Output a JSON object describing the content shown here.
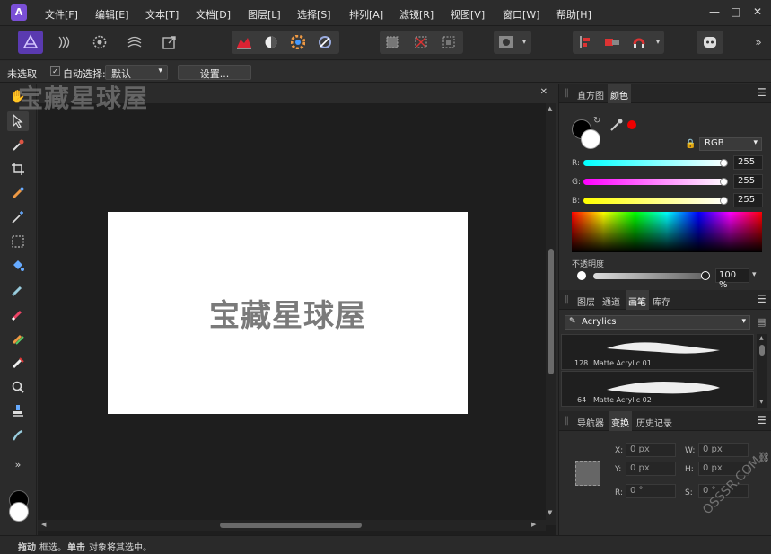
{
  "app": {
    "logo_letter": "A",
    "accent": "#7a4fd6"
  },
  "menu": [
    "文件[F]",
    "编辑[E]",
    "文本[T]",
    "文档[D]",
    "图层[L]",
    "选择[S]",
    "排列[A]",
    "滤镜[R]",
    "视图[V]",
    "窗口[W]",
    "帮助[H]"
  ],
  "window_controls": {
    "minimize": "—",
    "maximize": "□",
    "close": "✕"
  },
  "context": {
    "selection": "未选取",
    "auto_select_label": "自动选择:",
    "auto_select_checked": "✓",
    "mode": "默认",
    "settings": "设置..."
  },
  "watermark": {
    "top": "宝藏星球屋",
    "corner": "OSSSR.COM"
  },
  "document": {
    "text": "宝藏星球屋",
    "background": "#ffffff"
  },
  "canvas": {
    "close_glyph": "✕"
  },
  "panels": {
    "top_tabs": [
      "直方图",
      "颜色"
    ],
    "top_active": "颜色",
    "color_model": "RGB",
    "channels": [
      {
        "label": "R:",
        "value": "255",
        "gradient": "linear-gradient(90deg,#00ffff,#ffffff)"
      },
      {
        "label": "G:",
        "value": "255",
        "gradient": "linear-gradient(90deg,#ff00ff,#ffffff)"
      },
      {
        "label": "B:",
        "value": "255",
        "gradient": "linear-gradient(90deg,#ffff00,#ffffff)"
      }
    ],
    "opacity_label": "不透明度",
    "opacity_value": "100 %",
    "mid_tabs": [
      "图层",
      "通道",
      "画笔",
      "库存"
    ],
    "mid_active": "画笔",
    "brush_category": "Acrylics",
    "brushes": [
      {
        "size": "128",
        "name": "Matte Acrylic 01"
      },
      {
        "size": "64",
        "name": "Matte Acrylic 02"
      }
    ],
    "bottom_tabs": [
      "导航器",
      "变换",
      "历史记录"
    ],
    "bottom_active": "变换",
    "transform": {
      "x_label": "X:",
      "x": "0 px",
      "y_label": "Y:",
      "y": "0 px",
      "w_label": "W:",
      "w": "0 px",
      "h_label": "H:",
      "h": "0 px",
      "r_label": "R:",
      "r": "0 °",
      "s_label": "S:",
      "s": "0 °"
    }
  },
  "status": {
    "drag_bold": "拖动",
    "drag_text": "框选。",
    "click_bold": "单击",
    "click_text": "对象将其选中。"
  }
}
